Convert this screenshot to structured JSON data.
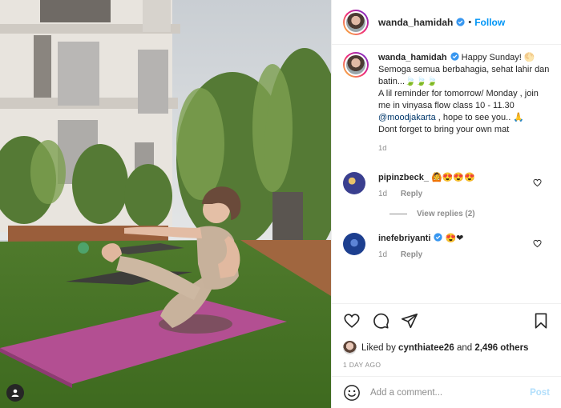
{
  "header": {
    "username": "wanda_hamidah",
    "separator": "•",
    "follow_label": "Follow"
  },
  "caption": {
    "username": "wanda_hamidah",
    "text_1": "Happy Sunday! 🌕",
    "text_2": "Semoga semua berbahagia, sehat lahir dan batin...🍃🍃🍃",
    "text_3": "A lil reminder for tomorrow/ Monday , join me in vinyasa flow class 10 - 11.30",
    "mention": "@moodjakarta",
    "text_4": ", hope to see you.. 🙏",
    "text_5": "Dont forget to bring your own mat",
    "time": "1d"
  },
  "comments": [
    {
      "username": "pipinzbeck_",
      "text": "🙆😍😍😍",
      "time": "1d",
      "reply_label": "Reply",
      "view_replies": "View replies (2)",
      "avatar_color": "#3a3f8f"
    },
    {
      "username": "inefebriyanti",
      "text": "😍❤",
      "time": "1d",
      "reply_label": "Reply",
      "avatar_color": "#1d3f8f"
    }
  ],
  "likes": {
    "prefix": "Liked by",
    "user": "cynthiatee26",
    "mid": "and",
    "count": "2,496 others"
  },
  "posted_ago": "1 DAY AGO",
  "composer": {
    "placeholder": "Add a comment...",
    "post_label": "Post"
  },
  "colors": {
    "accent": "#0095f6",
    "muted": "#8e8e8e",
    "mention": "#00376b"
  },
  "icons": [
    "user-tag-icon",
    "verified-badge-icon",
    "heart-icon",
    "comment-icon",
    "share-icon",
    "bookmark-icon",
    "emoji-icon"
  ]
}
